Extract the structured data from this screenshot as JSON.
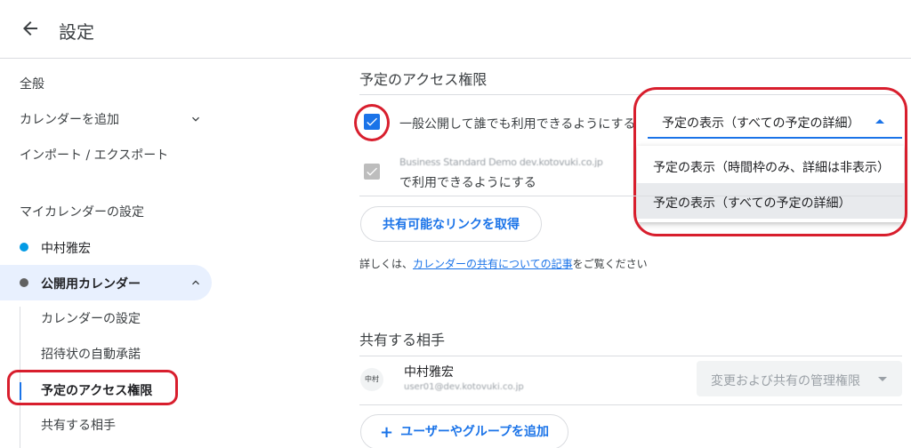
{
  "header": {
    "title": "設定"
  },
  "sidebar": {
    "nav": [
      {
        "label": "全般"
      },
      {
        "label": "カレンダーを追加"
      },
      {
        "label": "インポート / エクスポート"
      }
    ],
    "my_calendars_title": "マイカレンダーの設定",
    "calendars": [
      {
        "label": "中村雅宏",
        "color": "#039be5"
      },
      {
        "label": "公開用カレンダー",
        "color": "#616161"
      }
    ],
    "sub_items": [
      {
        "label": "カレンダーの設定"
      },
      {
        "label": "招待状の自動承諾"
      },
      {
        "label": "予定のアクセス権限"
      },
      {
        "label": "共有する相手"
      }
    ]
  },
  "access": {
    "title": "予定のアクセス権限",
    "public_checkbox_label": "一般公開して誰でも利用できるようにする",
    "org_checkbox_line1": "Business Standard Demo dev.kotovuki.co.jp",
    "org_checkbox_line2": "で利用できるようにする",
    "select_value": "予定の表示（すべての予定の詳細）",
    "dropdown_options": [
      {
        "label": "予定の表示（時間枠のみ、詳細は非表示）"
      },
      {
        "label": "予定の表示（すべての予定の詳細）"
      }
    ],
    "share_link_button": "共有可能なリンクを取得",
    "note_prefix": "詳しくは、",
    "note_link": "カレンダーの共有についての記事",
    "note_suffix": "をご覧ください"
  },
  "sharing": {
    "title": "共有する相手",
    "people": [
      {
        "avatar": "中村",
        "name": "中村雅宏",
        "email": "user01@dev.kotovuki.co.jp",
        "permission": "変更および共有の管理権限"
      }
    ],
    "add_button": "ユーザーやグループを追加",
    "add_plus": "+"
  },
  "colors": {
    "accent": "#1a73e8",
    "highlight": "#d81e2d",
    "active_bg": "#e8f0fe"
  }
}
